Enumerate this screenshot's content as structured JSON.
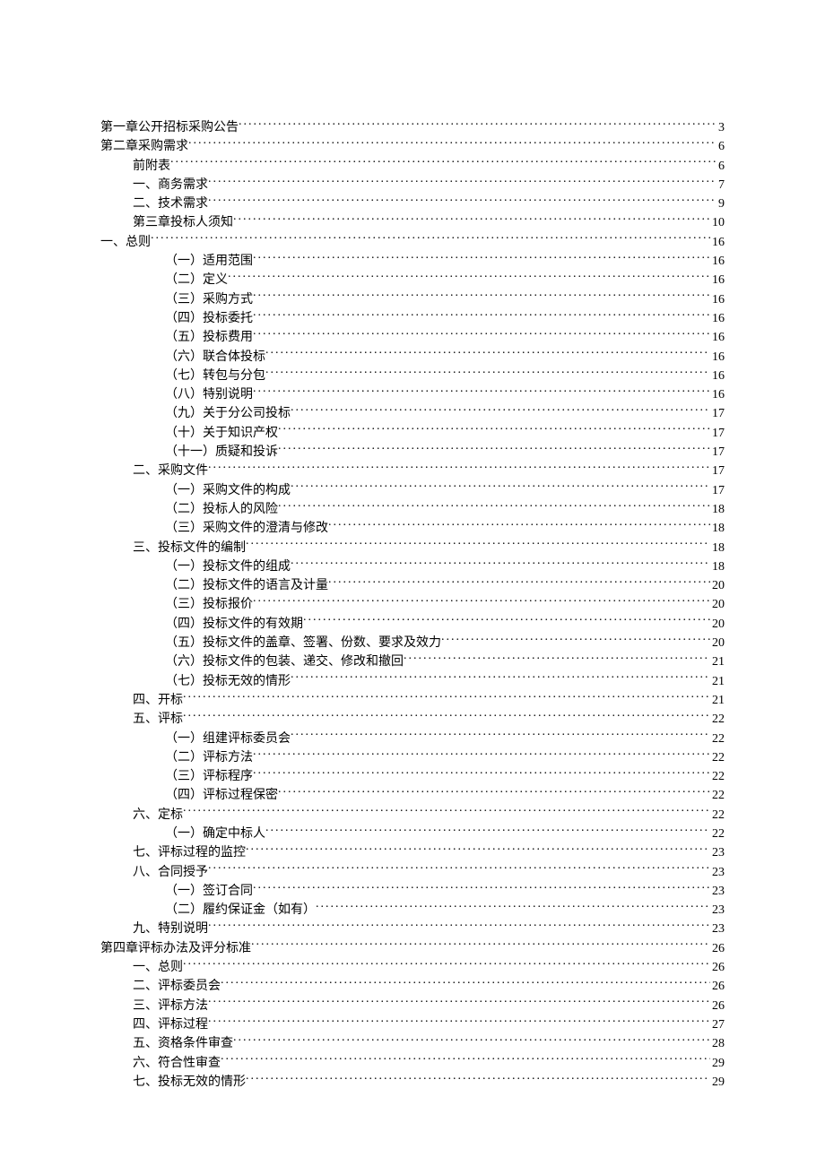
{
  "toc": [
    {
      "title": "第一章公开招标采购公告",
      "page": "3",
      "level": 0
    },
    {
      "title": "第二章采购需求",
      "page": "6",
      "level": 0
    },
    {
      "title": "前附表",
      "page": "6",
      "level": 1
    },
    {
      "title": "一、商务需求",
      "page": "7",
      "level": 1
    },
    {
      "title": "二、技术需求",
      "page": "9",
      "level": 1
    },
    {
      "title": "第三章投标人须知",
      "page": "10",
      "level": 1
    },
    {
      "title": "一、总则",
      "page": "16",
      "level": 0
    },
    {
      "title": "（一）适用范围 ",
      "page": "16",
      "level": 2
    },
    {
      "title": "（二）定义 ",
      "page": "16",
      "level": 2
    },
    {
      "title": "（三）采购方式 ",
      "page": "16",
      "level": 2
    },
    {
      "title": "（四）投标委托 ",
      "page": "16",
      "level": 2
    },
    {
      "title": "（五）投标费用 ",
      "page": "16",
      "level": 2
    },
    {
      "title": "（六）联合体投标 ",
      "page": "16",
      "level": 2
    },
    {
      "title": "（七）转包与分包 ",
      "page": "16",
      "level": 2
    },
    {
      "title": "（八）特别说明 ",
      "page": "16",
      "level": 2
    },
    {
      "title": "（九）关于分公司投标 ",
      "page": "17",
      "level": 2
    },
    {
      "title": "（十）关于知识产权 ",
      "page": "17",
      "level": 2
    },
    {
      "title": "（十一）质疑和投诉 ",
      "page": "17",
      "level": 2
    },
    {
      "title": "二、采购文件",
      "page": "17",
      "level": 1
    },
    {
      "title": "（一）采购文件的构成 ",
      "page": "17",
      "level": 2
    },
    {
      "title": "（二）投标人的风险 ",
      "page": "18",
      "level": 2
    },
    {
      "title": "（三）采购文件的澄清与修改 ",
      "page": "18",
      "level": 2
    },
    {
      "title": "三、投标文件的编制",
      "page": "18",
      "level": 1
    },
    {
      "title": "（一）投标文件的组成 ",
      "page": "18",
      "level": 2
    },
    {
      "title": "（二）投标文件的语言及计量 ",
      "page": "20",
      "level": 2
    },
    {
      "title": "（三）投标报价 ",
      "page": "20",
      "level": 2
    },
    {
      "title": "（四）投标文件的有效期 ",
      "page": "20",
      "level": 2
    },
    {
      "title": "（五）投标文件的盖章、签署、份数、要求及效力 ",
      "page": "20",
      "level": 2
    },
    {
      "title": "（六）投标文件的包装、递交、修改和撤回 ",
      "page": "21",
      "level": 2
    },
    {
      "title": "（七）投标无效的情形 ",
      "page": "21",
      "level": 2
    },
    {
      "title": "四、开标",
      "page": "21",
      "level": 1
    },
    {
      "title": "五、评标",
      "page": "22",
      "level": 1
    },
    {
      "title": "（一）组建评标委员会 ",
      "page": "22",
      "level": 2
    },
    {
      "title": "（二）评标方法 ",
      "page": "22",
      "level": 2
    },
    {
      "title": "（三）评标程序 ",
      "page": "22",
      "level": 2
    },
    {
      "title": "（四）评标过程保密 ",
      "page": "22",
      "level": 2
    },
    {
      "title": "六、定标",
      "page": "22",
      "level": 1
    },
    {
      "title": "（一）确定中标人 ",
      "page": "22",
      "level": 2
    },
    {
      "title": "七、评标过程的监控",
      "page": "23",
      "level": 1
    },
    {
      "title": "八、合同授予",
      "page": "23",
      "level": 1
    },
    {
      "title": "（一）签订合同 ",
      "page": "23",
      "level": 2
    },
    {
      "title": "（二）履约保证金（如有） ",
      "page": "23",
      "level": 2
    },
    {
      "title": "九、特别说明",
      "page": "23",
      "level": 1
    },
    {
      "title": "第四章评标办法及评分标准",
      "page": "26",
      "level": 0
    },
    {
      "title": "一、总则",
      "page": "26",
      "level": 1
    },
    {
      "title": "二、评标委员会",
      "page": "26",
      "level": 1
    },
    {
      "title": "三、评标方法",
      "page": "26",
      "level": 1
    },
    {
      "title": "四、评标过程",
      "page": "27",
      "level": 1
    },
    {
      "title": "五、资格条件审查",
      "page": "28",
      "level": 1
    },
    {
      "title": "六、符合性审查",
      "page": "29",
      "level": 1
    },
    {
      "title": "七、投标无效的情形",
      "page": "29",
      "level": 1
    }
  ]
}
